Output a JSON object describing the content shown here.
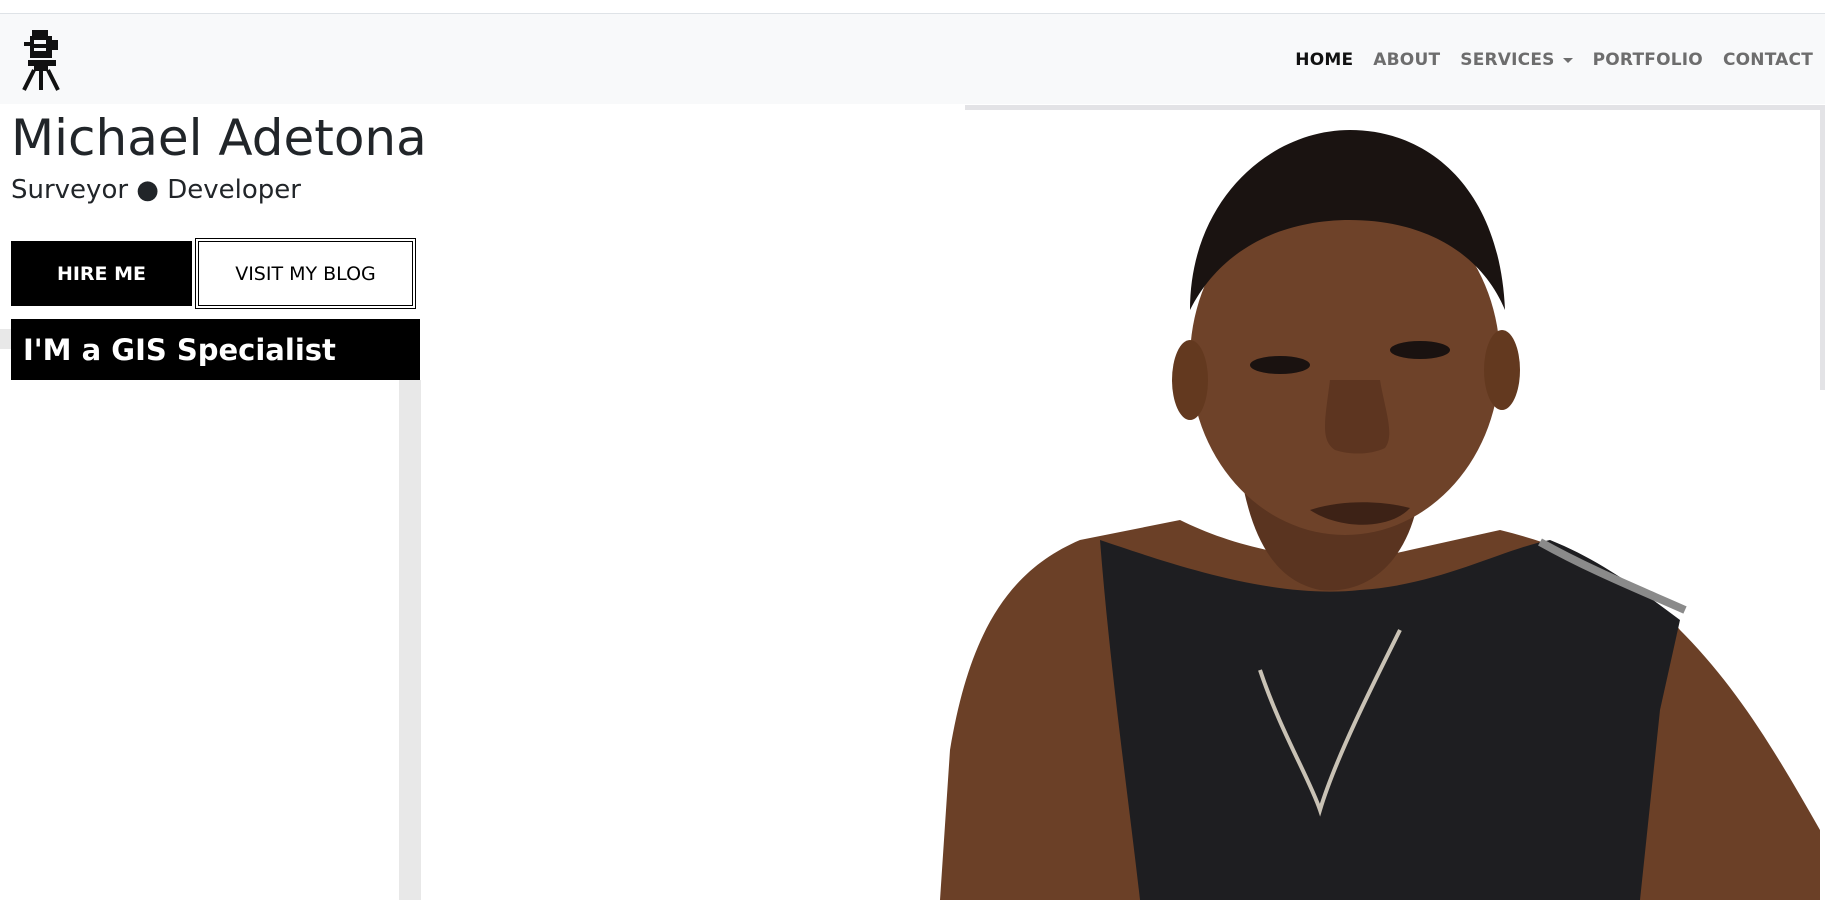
{
  "navbar": {
    "logo_icon": "surveyor-tripod-icon",
    "links": [
      {
        "label": "HOME",
        "active": true
      },
      {
        "label": "ABOUT",
        "active": false
      },
      {
        "label": "SERVICES",
        "active": false,
        "dropdown": true
      },
      {
        "label": "PORTFOLIO",
        "active": false
      },
      {
        "label": "CONTACT",
        "active": false
      }
    ]
  },
  "hero": {
    "name": "Michael Adetona",
    "subtitle": "Surveyor ● Developer",
    "hire_label": "HIRE ME",
    "blog_label": "VISIT MY BLOG",
    "specialist_text": "I'M a GIS Specialist"
  },
  "portrait": {
    "icon": "profile-portrait"
  },
  "colors": {
    "navbar_bg": "#f8f9fa",
    "active_link": "#111111",
    "inactive_link": "#6d6d6d",
    "button_dark": "#000000",
    "panel_bg": "#000000"
  }
}
